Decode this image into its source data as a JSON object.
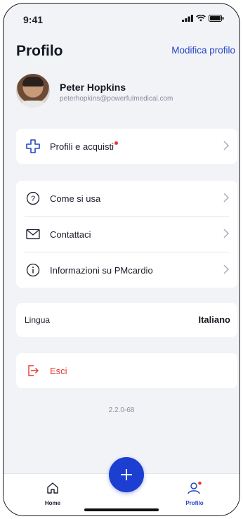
{
  "status_bar": {
    "time": "9:41"
  },
  "header": {
    "title": "Profilo",
    "edit_label": "Modifica profilo"
  },
  "user": {
    "name": "Peter Hopkins",
    "email": "peterhopkins@powerfulmedical.com"
  },
  "profiles_card": {
    "label": "Profili e acquisti",
    "has_notification": true
  },
  "info_card": {
    "items": [
      {
        "label": "Come si usa",
        "icon": "question-circle-icon"
      },
      {
        "label": "Contattaci",
        "icon": "mail-icon"
      },
      {
        "label": "Informazioni su PMcardio",
        "icon": "info-circle-icon"
      }
    ]
  },
  "language": {
    "label": "Lingua",
    "value": "Italiano"
  },
  "logout": {
    "label": "Esci"
  },
  "version": "2.2.0-68",
  "bottom_nav": {
    "home_label": "Home",
    "profile_label": "Profilo"
  },
  "colors": {
    "accent": "#2346c6",
    "fab": "#1c3fd1",
    "danger": "#e53935",
    "background": "#f2f3f7"
  }
}
